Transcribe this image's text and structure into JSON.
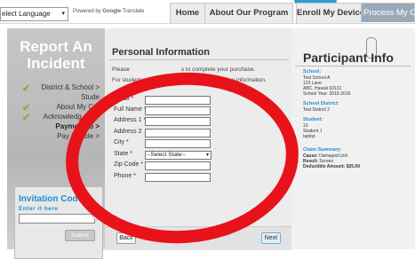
{
  "topbar": {
    "language_select": "elect Language",
    "powered_by": "Powered by",
    "google": "Google",
    "translate": "Translate",
    "nav": [
      {
        "label": "Home"
      },
      {
        "label": "About Our Program"
      },
      {
        "label": "Enroll My Device"
      },
      {
        "label": "Process My Cl"
      }
    ]
  },
  "sidebar": {
    "title_line1": "Report An",
    "title_line2": "Incident",
    "steps": [
      {
        "label": "District & School >",
        "done": true
      },
      {
        "label": "Stude",
        "done": false
      },
      {
        "label": "About My C  >",
        "done": true
      },
      {
        "label": "Acknowledg  ent >",
        "done": true
      },
      {
        "label": "Payme  Info >",
        "done": false,
        "current": true
      },
      {
        "label": "Pay De  ible >",
        "done": false
      }
    ],
    "invite": {
      "title": "Invitation Code?",
      "subtitle": "Enter it here",
      "submit": "Submit"
    }
  },
  "form": {
    "title": "Personal Information",
    "intro_left1": "Please",
    "intro_right1": "s to complete your purchase.",
    "intro_left2": "For student registrations, please input",
    "intro_right2": "guardian information.",
    "fields": [
      {
        "label": "Email *",
        "value": ""
      },
      {
        "label": "Full Name *",
        "value": ""
      },
      {
        "label": "Address 1 *",
        "value": ""
      },
      {
        "label": "Address 2",
        "value": ""
      },
      {
        "label": "City *",
        "value": ""
      },
      {
        "label": "State *",
        "value": "--Select State--"
      },
      {
        "label": "Zip Code *",
        "value": ""
      },
      {
        "label": "Phone *",
        "value": ""
      }
    ],
    "back": "Back",
    "next": "Next"
  },
  "participant": {
    "title": "Participant Info",
    "school_h": "School:",
    "school_lines": [
      "Test School A",
      "123 Lane",
      "ABC, Hawaii 63131",
      "School Year: 2015-2016"
    ],
    "district_h": "School District:",
    "district_line": "Test District 2",
    "student_h": "Student:",
    "student_lines": [
      "10",
      "Student J",
      "laptop"
    ],
    "claim_h": "Claim Summary:",
    "claim_lines": [
      {
        "label": "Cause:",
        "value": "Damaged Unit"
      },
      {
        "label": "Result:",
        "value": "Screen"
      },
      {
        "label": "Deductible Amount:",
        "value": "$25.00"
      }
    ]
  },
  "colors": {
    "accent": "#1a8fd0",
    "annotation": "#e8121b",
    "check": "#7fb13a"
  }
}
